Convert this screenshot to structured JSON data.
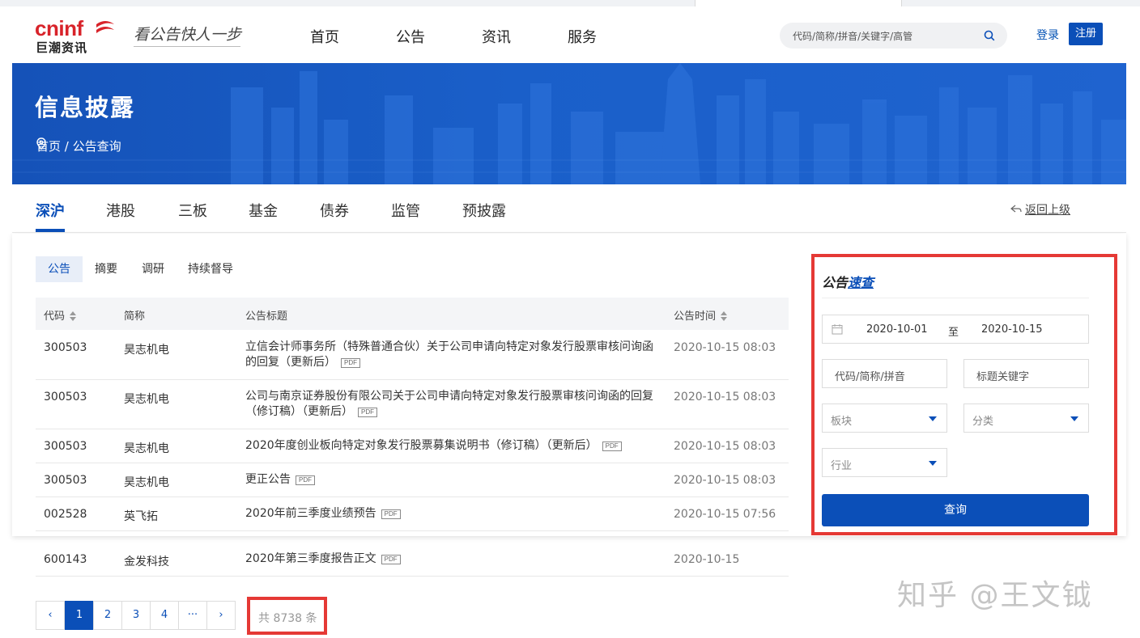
{
  "header": {
    "logo_en": "cninf",
    "logo_cn": "巨潮资讯",
    "slogan": "看公告快人一步",
    "nav": [
      "首页",
      "公告",
      "资讯",
      "服务"
    ],
    "search_placeholder": "代码/简称/拼音/关键字/高管",
    "login": "登录",
    "register": "注册"
  },
  "banner": {
    "title": "信息披露",
    "breadcrumb": "首页 / 公告查询"
  },
  "market_tabs": [
    "深沪",
    "港股",
    "三板",
    "基金",
    "债券",
    "监管",
    "预披露"
  ],
  "back_label": "返回上级",
  "sub_tabs": [
    "公告",
    "摘要",
    "调研",
    "持续督导"
  ],
  "table": {
    "headers": [
      "代码",
      "简称",
      "公告标题",
      "公告时间"
    ],
    "pdf_label": "PDF",
    "rows": [
      {
        "code": "300503",
        "name": "昊志机电",
        "title": "立信会计师事务所（特殊普通合伙）关于公司申请向特定对象发行股票审核问询函的回复（更新后）",
        "time": "2020-10-15 08:03"
      },
      {
        "code": "300503",
        "name": "昊志机电",
        "title": "公司与南京证券股份有限公司关于公司申请向特定对象发行股票审核问询函的回复（修订稿）（更新后）",
        "time": "2020-10-15 08:03"
      },
      {
        "code": "300503",
        "name": "昊志机电",
        "title": "2020年度创业板向特定对象发行股票募集说明书（修订稿）（更新后）",
        "time": "2020-10-15 08:03"
      },
      {
        "code": "300503",
        "name": "昊志机电",
        "title": "更正公告",
        "time": "2020-10-15 08:03"
      },
      {
        "code": "002528",
        "name": "英飞拓",
        "title": "2020年前三季度业绩预告",
        "time": "2020-10-15 07:56"
      },
      {
        "code": "600143",
        "name": "金发科技",
        "title": "2020年第三季度报告正文",
        "time": "2020-10-15"
      }
    ]
  },
  "pagination": {
    "prev": "‹",
    "pages": [
      "1",
      "2",
      "3",
      "4"
    ],
    "more": "···",
    "next": "›",
    "total": "共 8738 条"
  },
  "quick_search": {
    "title_a": "公告",
    "title_b": "速查",
    "date_from": "2020-10-01",
    "date_sep": "至",
    "date_to": "2020-10-15",
    "code_placeholder": "代码/简称/拼音",
    "keyword_placeholder": "标题关键字",
    "board": "板块",
    "category": "分类",
    "industry": "行业",
    "button": "查询"
  },
  "watermark": "知乎 @王文钺",
  "colors": {
    "primary": "#0b4fb8",
    "highlight_box": "#e53935",
    "brand_red": "#d8232a"
  }
}
